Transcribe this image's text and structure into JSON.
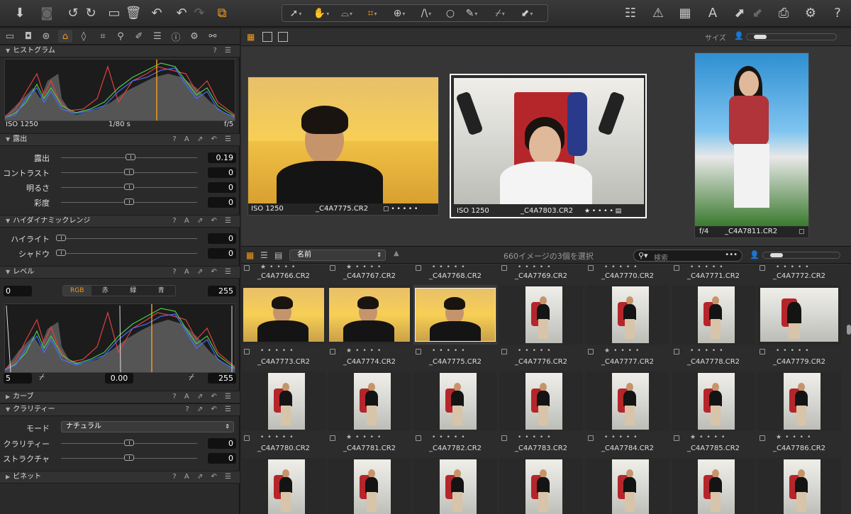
{
  "toolbar": {
    "left_icons": [
      "import-icon",
      "camera-icon",
      "rotate-left-icon",
      "rotate-right-icon",
      "move-to-folder-icon",
      "trash-icon",
      "undo-icon",
      "undo-alt-icon",
      "redo-icon",
      "copy-adjustments-icon"
    ],
    "right_icons": [
      "layout-icon",
      "warning-icon",
      "grid-icon",
      "text-icon",
      "copy-arrow-icon",
      "paste-arrow-icon",
      "print-icon",
      "gear-icon",
      "help-icon"
    ]
  },
  "tool_palette": [
    "pointer-icon",
    "hand-icon",
    "crop-frame-icon",
    "crop-icon",
    "rotate-icon",
    "keystone-icon",
    "circle-icon",
    "brush-icon",
    "picker-icon",
    "arrow-icon"
  ],
  "left_tabs": [
    "folder-tab",
    "camera-tab",
    "color-tab",
    "exposure-tab",
    "lens-tab",
    "crop-tab",
    "details-tab",
    "brush-tab",
    "metadata-tab",
    "info-tab",
    "settings-tab",
    "output-tab"
  ],
  "histogram": {
    "title": "ヒストグラム",
    "iso": "ISO 1250",
    "shutter": "1/80 s",
    "aperture": "f/5"
  },
  "exposure": {
    "title": "露出",
    "rows": [
      {
        "label": "露出",
        "value": "0.19"
      },
      {
        "label": "コントラスト",
        "value": "0"
      },
      {
        "label": "明るさ",
        "value": "0"
      },
      {
        "label": "彩度",
        "value": "0"
      }
    ]
  },
  "hdr": {
    "title": "ハイダイナミックレンジ",
    "rows": [
      {
        "label": "ハイライト",
        "value": "0"
      },
      {
        "label": "シャドウ",
        "value": "0"
      }
    ]
  },
  "levels": {
    "title": "レベル",
    "low": "0",
    "high": "255",
    "tabs": [
      "RGB",
      "赤",
      "緑",
      "青"
    ],
    "out_low": "5",
    "mid": "0.00",
    "out_high": "255"
  },
  "curve": {
    "title": "カーブ"
  },
  "clarity": {
    "title": "クラリティー",
    "mode_label": "モード",
    "mode_value": "ナチュラル",
    "rows": [
      {
        "label": "クラリティー",
        "value": "0"
      },
      {
        "label": "ストラクチャ",
        "value": "0"
      }
    ]
  },
  "vignette": {
    "title": "ビネット"
  },
  "viewer": {
    "size_label": "サイズ",
    "cards": [
      {
        "iso": "ISO 1250",
        "file": "_C4A7775.CR2"
      },
      {
        "iso": "ISO 1250",
        "file": "_C4A7803.CR2"
      },
      {
        "iso": "f/4",
        "file": "_C4A7811.CR2"
      }
    ]
  },
  "browser": {
    "sort": "名前",
    "status": "660イメージの3個を選択",
    "search_placeholder": "検索"
  },
  "grid": {
    "row0": [
      "_C4A7766.CR2",
      "_C4A7767.CR2",
      "_C4A7768.CR2",
      "_C4A7769.CR2",
      "_C4A7770.CR2",
      "_C4A7771.CR2",
      "_C4A7772.CR2"
    ],
    "row1": [
      "_C4A7773.CR2",
      "_C4A7774.CR2",
      "_C4A7775.CR2",
      "_C4A7776.CR2",
      "_C4A7777.CR2",
      "_C4A7778.CR2",
      "_C4A7779.CR2"
    ],
    "row2": [
      "_C4A7780.CR2",
      "_C4A7781.CR2",
      "_C4A7782.CR2",
      "_C4A7783.CR2",
      "_C4A7784.CR2",
      "_C4A7785.CR2",
      "_C4A7786.CR2"
    ]
  },
  "colors": {
    "accent": "#f29a1b",
    "red": "#e24040",
    "green": "#4ccc4c",
    "blue": "#4a6bff"
  }
}
